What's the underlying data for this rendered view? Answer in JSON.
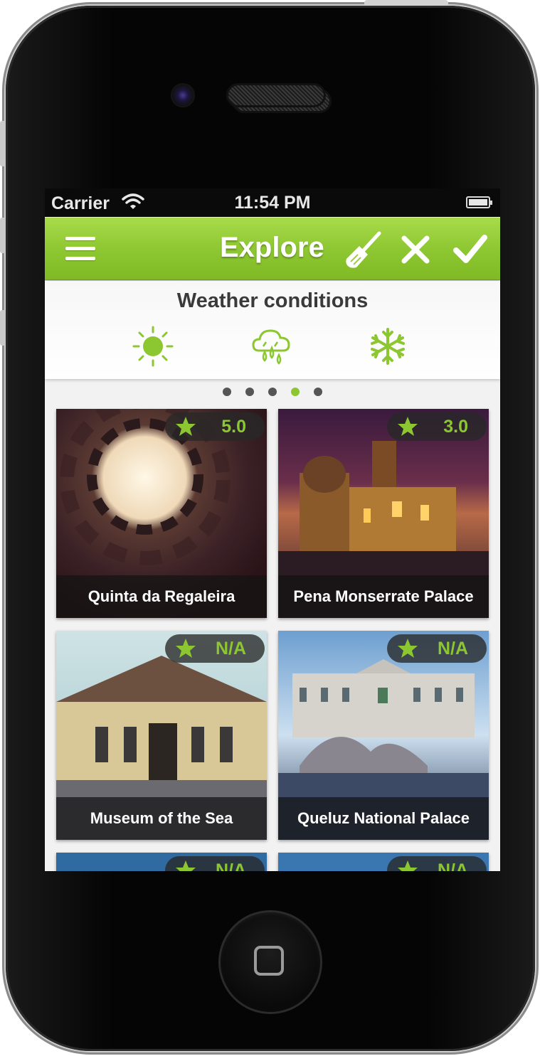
{
  "status_bar": {
    "carrier": "Carrier",
    "time": "11:54 PM"
  },
  "nav": {
    "title": "Explore"
  },
  "weather": {
    "title": "Weather conditions",
    "options": [
      "sun-icon",
      "rain-icon",
      "snow-icon"
    ]
  },
  "pager": {
    "count": 5,
    "active_index": 3
  },
  "places": [
    {
      "name": "Quinta da Regaleira",
      "rating": "5.0"
    },
    {
      "name": "Pena Monserrate Palace",
      "rating": "3.0"
    },
    {
      "name": "Museum of the Sea",
      "rating": "N/A"
    },
    {
      "name": "Queluz National Palace",
      "rating": "N/A"
    },
    {
      "name": "",
      "rating": "N/A"
    },
    {
      "name": "",
      "rating": "N/A"
    }
  ],
  "colors": {
    "accent": "#8cc630",
    "nav_top": "#a8db4a",
    "nav_bottom": "#7fba25",
    "text_dark": "#3a3a3a"
  }
}
